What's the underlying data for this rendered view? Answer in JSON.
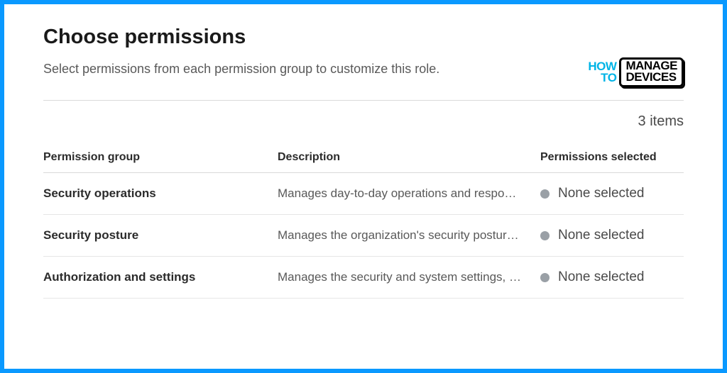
{
  "header": {
    "title": "Choose permissions",
    "subtitle": "Select permissions from each permission group to customize this role."
  },
  "brand": {
    "how": "HOW",
    "to": "TO",
    "manage": "MANAGE",
    "devices": "DEVICES"
  },
  "items_count": "3 items",
  "columns": {
    "group": "Permission group",
    "description": "Description",
    "selected": "Permissions selected"
  },
  "rows": [
    {
      "group": "Security operations",
      "description": "Manages day-to-day operations and respo…",
      "selected": "None selected"
    },
    {
      "group": "Security posture",
      "description": "Manages the organization's security postur…",
      "selected": "None selected"
    },
    {
      "group": "Authorization and settings",
      "description": "Manages the security and system settings, …",
      "selected": "None selected"
    }
  ]
}
